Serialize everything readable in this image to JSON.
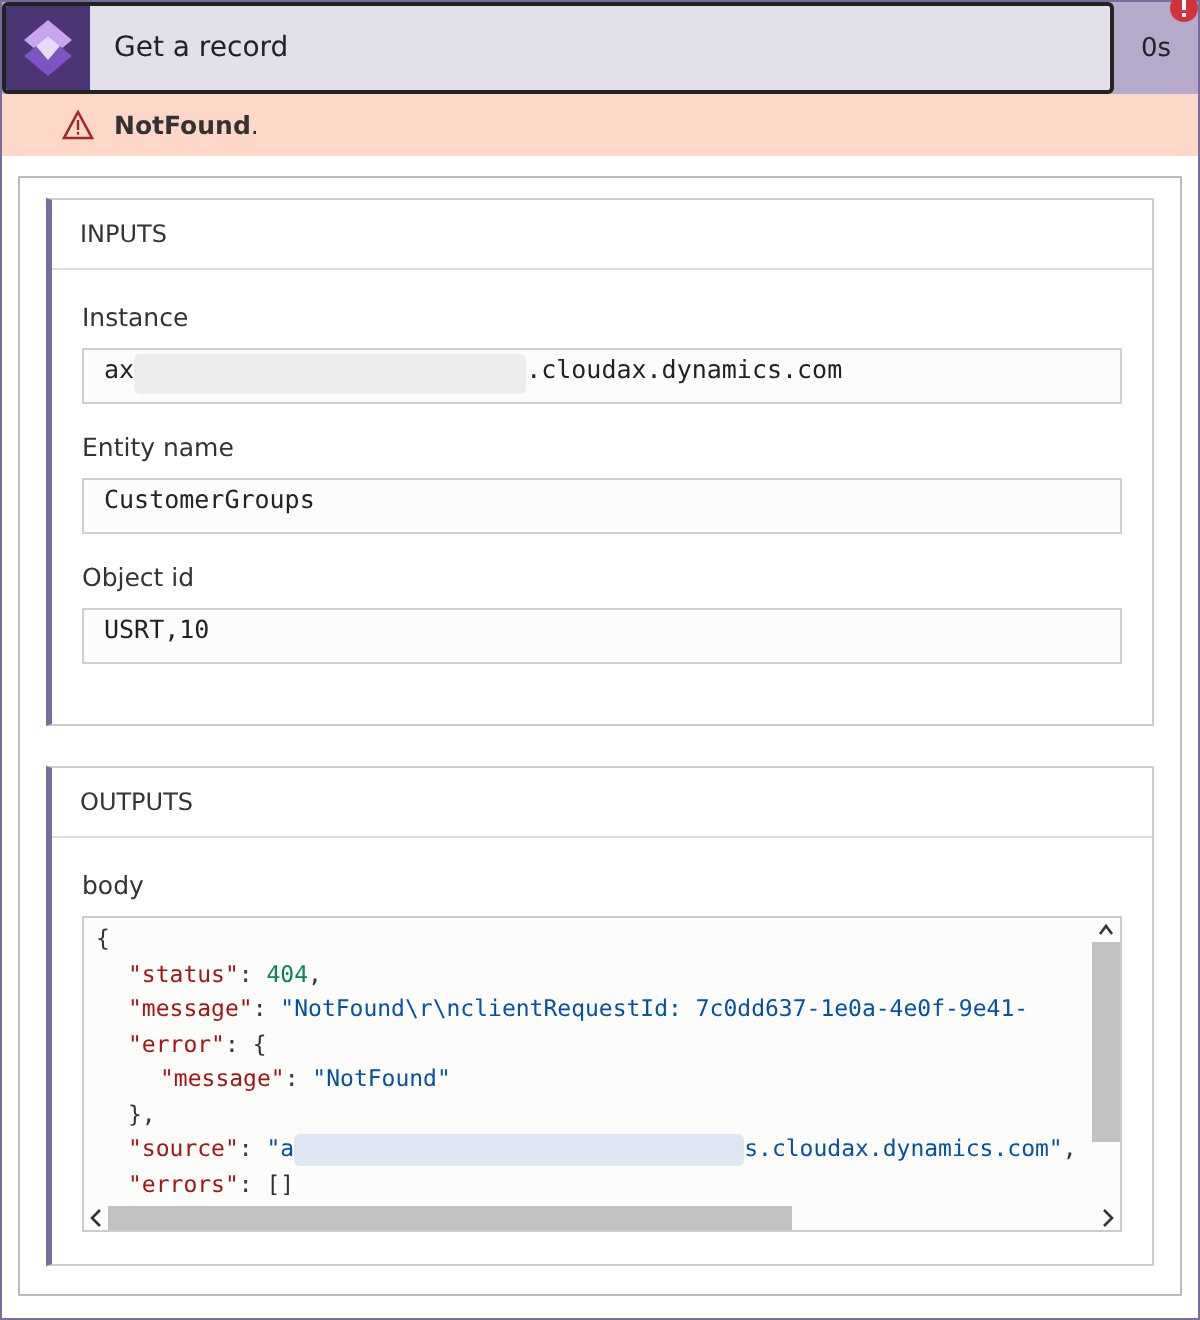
{
  "action": {
    "title": "Get a record",
    "duration": "0s",
    "failed": true
  },
  "error_banner": {
    "text": "NotFound",
    "trailing": "."
  },
  "sections": [
    {
      "heading": "INPUTS",
      "fields": [
        {
          "label": "Instance",
          "kind": "redacted",
          "value_start": "ax",
          "value_end": ".cloudax.dynamics.com"
        },
        {
          "label": "Entity name",
          "kind": "plain",
          "value": "CustomerGroups"
        },
        {
          "label": "Object id",
          "kind": "plain",
          "value": "USRT,10"
        }
      ]
    },
    {
      "heading": "OUTPUTS",
      "fields": [
        {
          "label": "body",
          "kind": "code",
          "lines": [
            {
              "tokens": [
                {
                  "kind": "punct",
                  "text": "{"
                }
              ],
              "children": [
                {
                  "tokens": [
                    {
                      "kind": "key",
                      "text": "\"status\""
                    },
                    {
                      "kind": "punct",
                      "text": ": "
                    },
                    {
                      "kind": "number",
                      "text": "404"
                    },
                    {
                      "kind": "punct",
                      "text": ","
                    }
                  ]
                },
                {
                  "tokens": [
                    {
                      "kind": "key",
                      "text": "\"message\""
                    },
                    {
                      "kind": "punct",
                      "text": ": "
                    },
                    {
                      "kind": "string",
                      "text": "\"NotFound\\r\\nclientRequestId: 7c0dd637-1e0a-4e0f-9e41-"
                    }
                  ]
                },
                {
                  "tokens": [
                    {
                      "kind": "key",
                      "text": "\"error\""
                    },
                    {
                      "kind": "punct",
                      "text": ": {"
                    }
                  ],
                  "children": [
                    {
                      "tokens": [
                        {
                          "kind": "key",
                          "text": "\"message\""
                        },
                        {
                          "kind": "punct",
                          "text": ": "
                        },
                        {
                          "kind": "string",
                          "text": "\"NotFound\""
                        }
                      ]
                    }
                  ]
                },
                {
                  "tokens": [
                    {
                      "kind": "punct",
                      "text": "},"
                    }
                  ]
                },
                {
                  "tokens": [
                    {
                      "kind": "key",
                      "text": "\"source\""
                    },
                    {
                      "kind": "punct",
                      "text": ": "
                    },
                    {
                      "kind": "string",
                      "text": "\"a"
                    },
                    {
                      "kind": "redacted"
                    },
                    {
                      "kind": "string",
                      "text": "s.cloudax.dynamics.com\""
                    },
                    {
                      "kind": "punct",
                      "text": ","
                    }
                  ]
                },
                {
                  "tokens": [
                    {
                      "kind": "key",
                      "text": "\"errors\""
                    },
                    {
                      "kind": "punct",
                      "text": ": []"
                    }
                  ]
                }
              ]
            }
          ]
        }
      ]
    }
  ]
}
